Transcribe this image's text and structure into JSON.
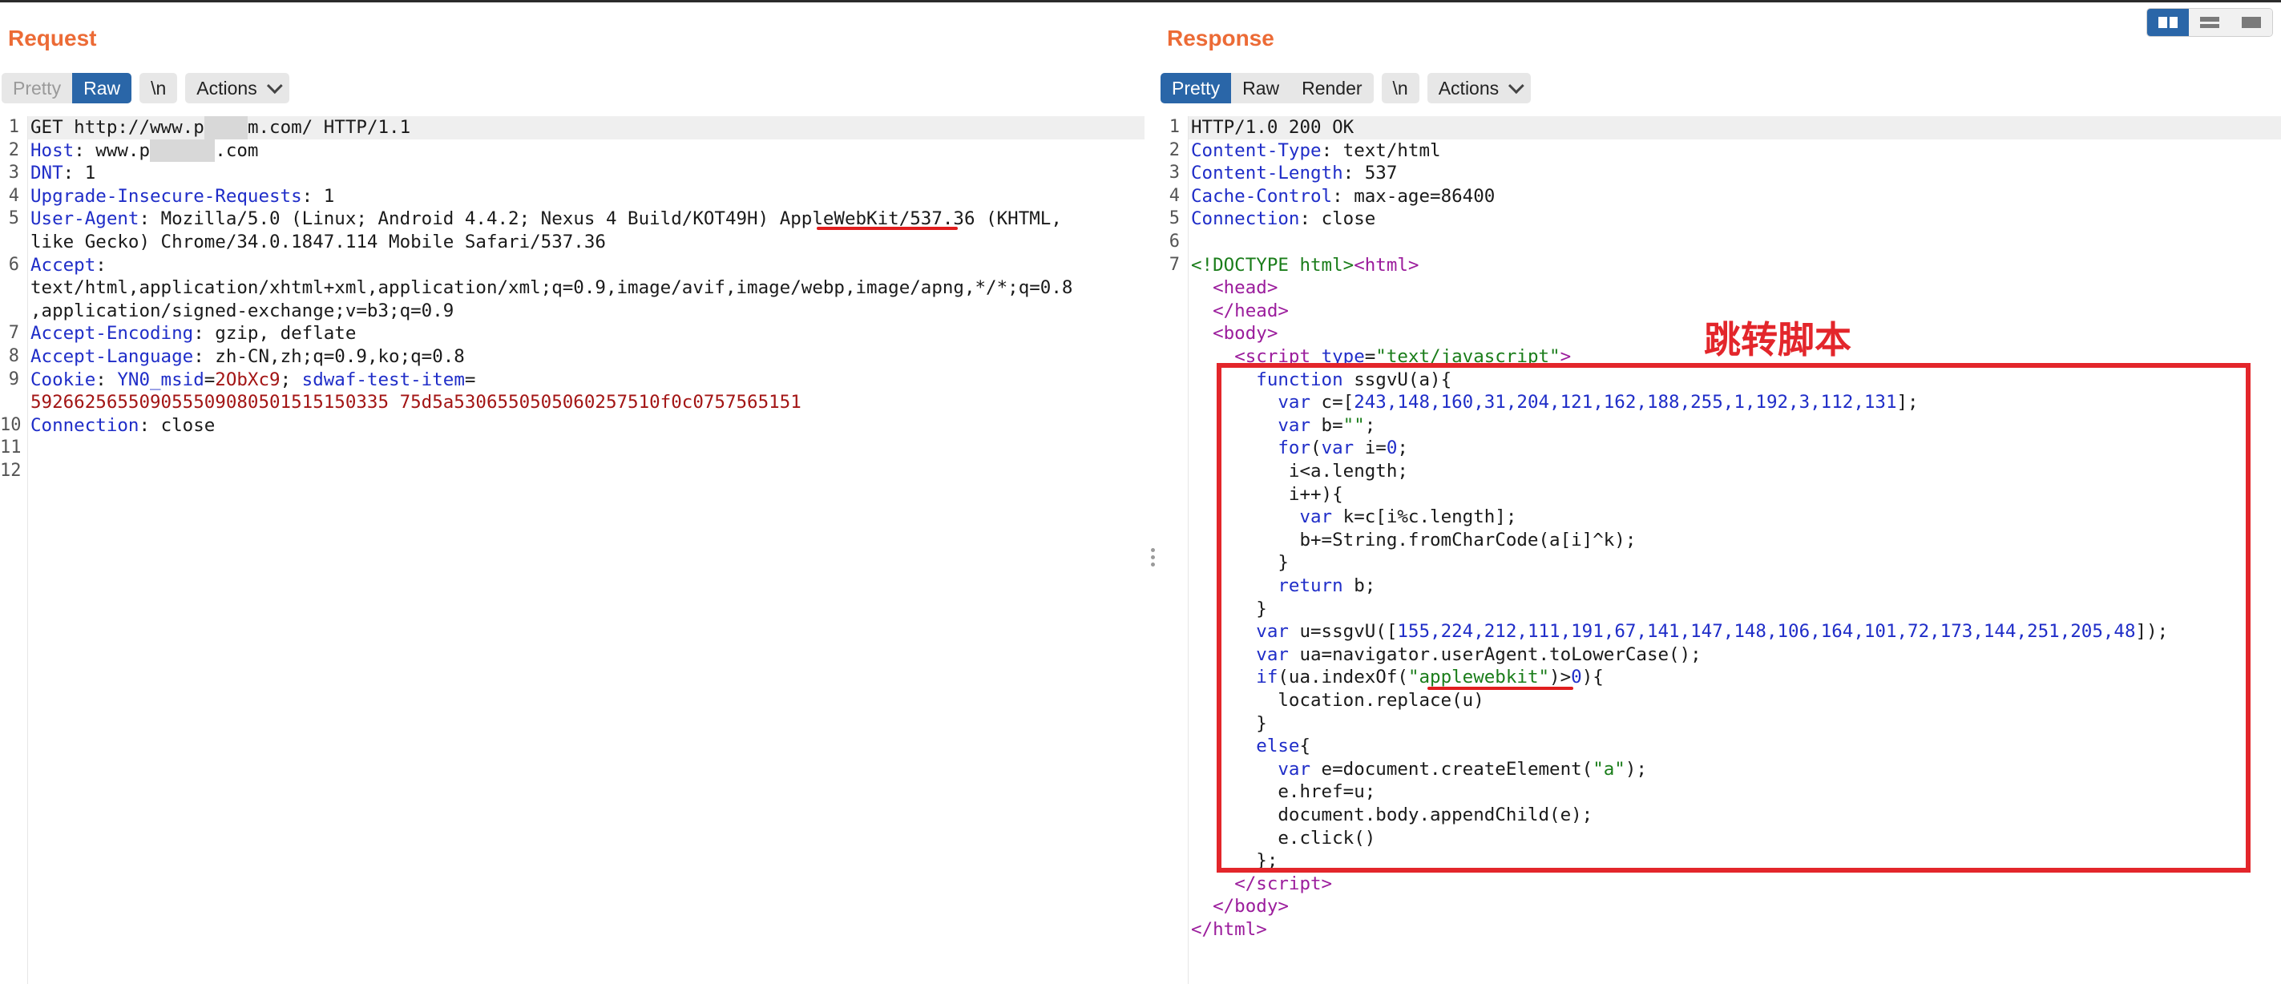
{
  "request": {
    "title": "Request",
    "toolbar": {
      "pretty": "Pretty",
      "raw": "Raw",
      "newline": "\\n",
      "actions": "Actions"
    }
  },
  "response": {
    "title": "Response",
    "toolbar": {
      "pretty": "Pretty",
      "raw": "Raw",
      "render": "Render",
      "newline": "\\n",
      "actions": "Actions"
    },
    "annotation": "跳转脚本"
  },
  "request_lines": {
    "l1": {
      "method": "GET http://www.p",
      "host_end": "m.com/ HTTP/1.1"
    },
    "l2": {
      "name": "Host",
      "value_a": "www.p",
      "value_b": ".com"
    },
    "l3": {
      "name": "DNT",
      "value": "1"
    },
    "l4": {
      "name": "Upgrade-Insecure-Requests",
      "value": "1"
    },
    "l5": {
      "name": "User-Agent",
      "value": "Mozilla/5.0 (Linux; Android 4.4.2; Nexus 4 Build/KOT49H) AppleWebKit/537.36 (KHTML,",
      "cont": "like Gecko) Chrome/34.0.1847.114 Mobile Safari/537.36"
    },
    "l6": {
      "name": "Accept",
      "value_1": "text/html,application/xhtml+xml,application/xml;q=0.9,image/avif,image/webp,image/apng,*/*;q=0.8",
      "value_2": ",application/signed-exchange;v=b3;q=0.9"
    },
    "l7": {
      "name": "Accept-Encoding",
      "value": "gzip, deflate"
    },
    "l8": {
      "name": "Accept-Language",
      "value": "zh-CN,zh;q=0.9,ko;q=0.8"
    },
    "l9": {
      "name": "Cookie",
      "c1_name": "YN0_msid",
      "c1_val": "2ObXc9",
      "c2_name": "sdwaf-test-item",
      "c2_val": "5926625655090555090805015151503357 5d5a5306550505060257510f0c0757565151"
    },
    "l10": {
      "name": "Connection",
      "value": "close"
    }
  },
  "response_lines": {
    "r1": "HTTP/1.0 200 OK",
    "r2": {
      "name": "Content-Type",
      "value": "text/html"
    },
    "r3": {
      "name": "Content-Length",
      "value": "537"
    },
    "r4": {
      "name": "Cache-Control",
      "value": "max-age=86400"
    },
    "r5": {
      "name": "Connection",
      "value": "close"
    },
    "js_c_array": "243,148,160,31,204,121,162,188,255,1,192,3,112,131",
    "js_u_array": "155,224,212,111,191,67,141,147,148,106,164,101,72,173,144,251,205,48",
    "js_match": "applewebkit"
  }
}
